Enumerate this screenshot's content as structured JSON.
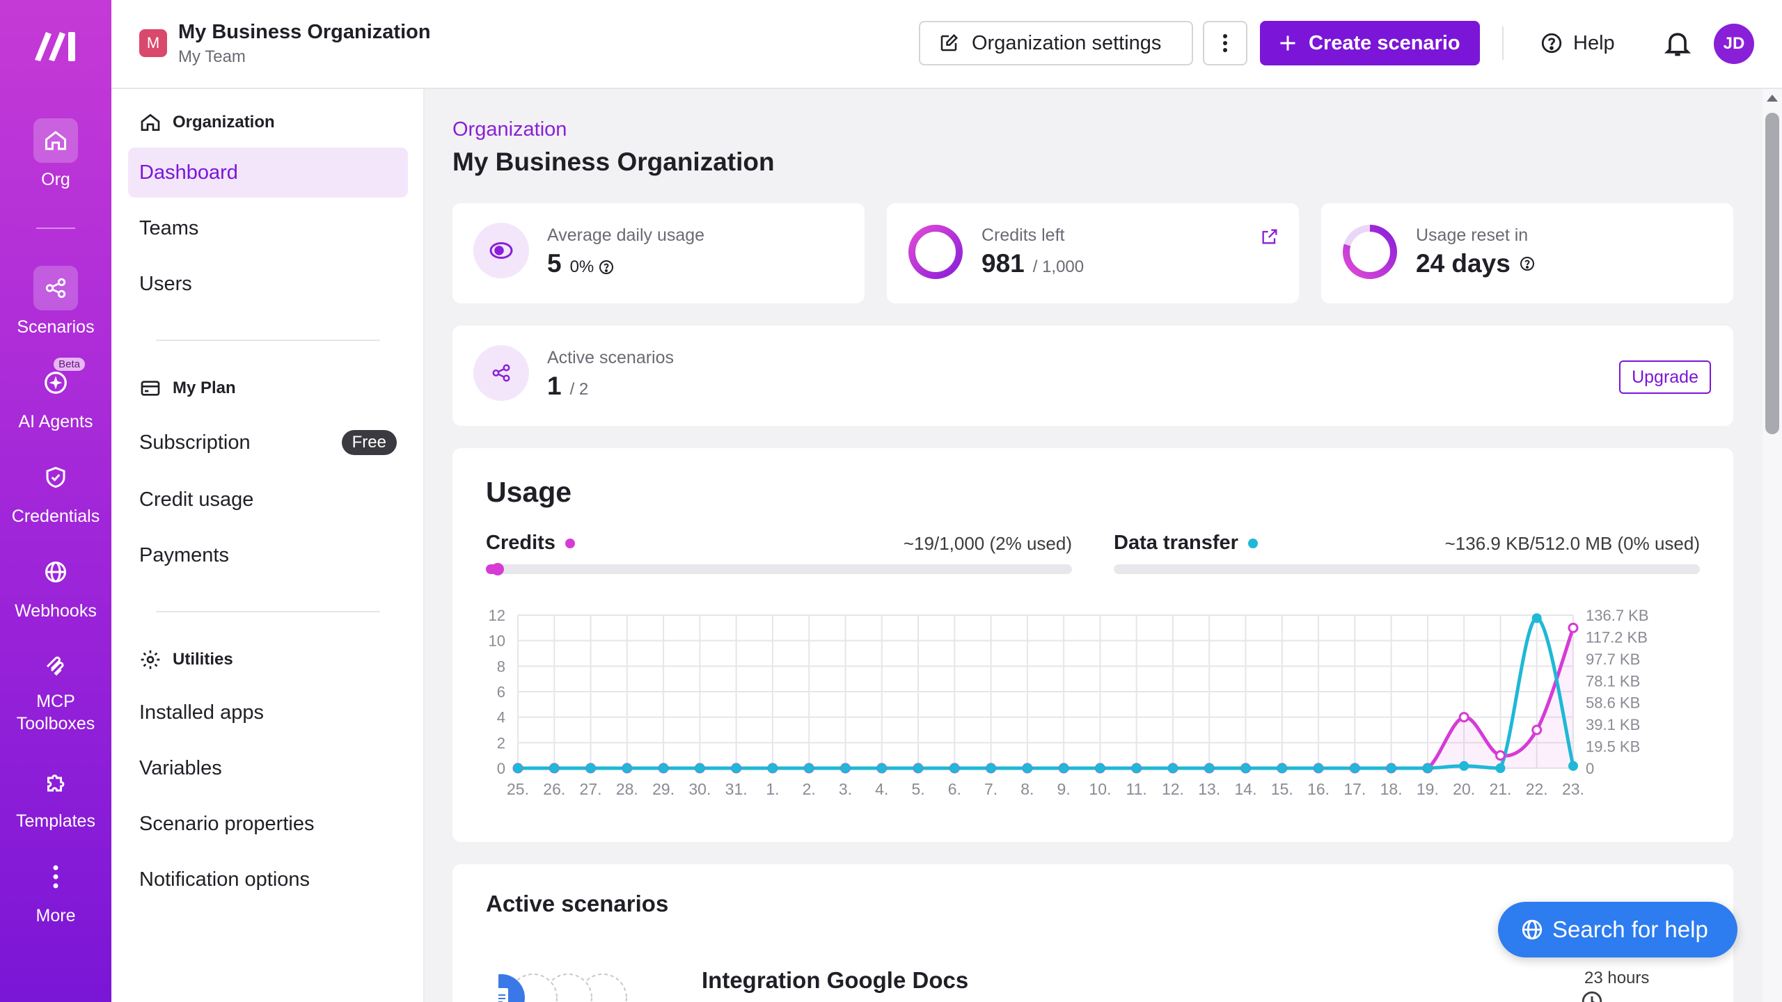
{
  "rail": {
    "items": [
      {
        "label": "Org",
        "icon": "home-icon"
      },
      {
        "label": "Scenarios",
        "icon": "share-icon"
      },
      {
        "label": "AI Agents",
        "icon": "sparkle-icon",
        "badge": "Beta"
      },
      {
        "label": "Credentials",
        "icon": "shield-icon"
      },
      {
        "label": "Webhooks",
        "icon": "globe-icon"
      },
      {
        "label": "MCP\nToolboxes",
        "icon": "mcp-icon"
      },
      {
        "label": "Templates",
        "icon": "puzzle-icon"
      },
      {
        "label": "More",
        "icon": "more-vertical-icon"
      }
    ]
  },
  "header": {
    "org_initial": "M",
    "org_name": "My Business Organization",
    "team_name": "My Team",
    "settings_label": "Organization settings",
    "create_label": "Create scenario",
    "help_label": "Help",
    "avatar_initials": "JD"
  },
  "sidebar": {
    "sections": {
      "organization": "Organization",
      "my_plan": "My Plan",
      "utilities": "Utilities"
    },
    "org_items": [
      "Dashboard",
      "Teams",
      "Users"
    ],
    "plan_items": [
      "Subscription",
      "Credit usage",
      "Payments"
    ],
    "plan_badge": "Free",
    "utility_items": [
      "Installed apps",
      "Variables",
      "Scenario properties",
      "Notification options"
    ]
  },
  "main": {
    "breadcrumb": "Organization",
    "title": "My Business Organization",
    "stats": {
      "avg_label": "Average daily usage",
      "avg_value": "5",
      "avg_pct": "0%",
      "credits_label": "Credits left",
      "credits_value": "981",
      "credits_total": "/ 1,000",
      "reset_label": "Usage reset in",
      "reset_value": "24 days",
      "active_label": "Active scenarios",
      "active_value": "1",
      "active_total": "/ 2",
      "upgrade_label": "Upgrade"
    },
    "usage": {
      "title": "Usage",
      "credits_name": "Credits",
      "credits_summary": "~19/1,000 (2% used)",
      "credits_fraction": 0.02,
      "transfer_name": "Data transfer",
      "transfer_summary": "~136.9 KB/512.0 MB (0% used)",
      "transfer_fraction": 0.0
    },
    "active_scenarios": {
      "title": "Active scenarios",
      "scenario_name": "Integration Google Docs",
      "scenario_time": "23 hours"
    },
    "help_fab": "Search for help"
  },
  "colors": {
    "credits": "#d63bd6",
    "transfer": "#1fb8d6",
    "accent": "#7b16d8"
  },
  "chart_data": {
    "type": "line",
    "x": [
      "25.",
      "26.",
      "27.",
      "28.",
      "29.",
      "30.",
      "31.",
      "1.",
      "2.",
      "3.",
      "4.",
      "5.",
      "6.",
      "7.",
      "8.",
      "9.",
      "10.",
      "11.",
      "12.",
      "13.",
      "14.",
      "15.",
      "16.",
      "17.",
      "18.",
      "19.",
      "20.",
      "21.",
      "22.",
      "23."
    ],
    "y_left_ticks": [
      "0",
      "2",
      "4",
      "6",
      "8",
      "10",
      "12"
    ],
    "y_right_ticks": [
      "0",
      "19.5 KB",
      "39.1 KB",
      "58.6 KB",
      "78.1 KB",
      "97.7 KB",
      "117.2 KB",
      "136.7 KB"
    ],
    "ylim_left": [
      0,
      12
    ],
    "ylim_right_kb": [
      0,
      136.7
    ],
    "grid": true,
    "series": [
      {
        "name": "Credits",
        "axis": "left",
        "values": [
          0,
          0,
          0,
          0,
          0,
          0,
          0,
          0,
          0,
          0,
          0,
          0,
          0,
          0,
          0,
          0,
          0,
          0,
          0,
          0,
          0,
          0,
          0,
          0,
          0,
          0,
          4,
          1,
          3,
          11
        ]
      },
      {
        "name": "Data transfer",
        "axis": "right",
        "values_kb": [
          0,
          0,
          0,
          0,
          0,
          0,
          0,
          0,
          0,
          0,
          0,
          0,
          0,
          0,
          0,
          0,
          0,
          0,
          0,
          0,
          0,
          0,
          0,
          0,
          0,
          0,
          2,
          0,
          134,
          2
        ]
      }
    ]
  }
}
